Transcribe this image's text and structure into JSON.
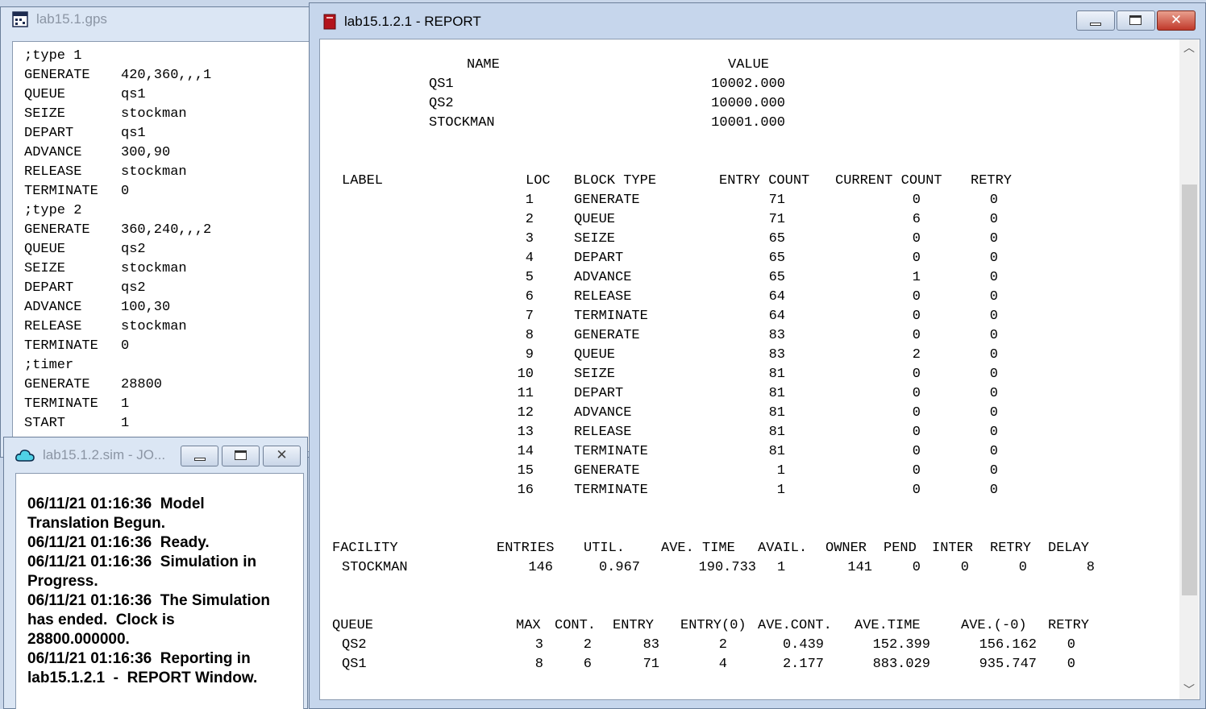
{
  "gps_window": {
    "title": "lab15.1.gps",
    "icon": "gps-file-icon",
    "lines": [
      {
        "kw": ";type 1",
        "arg": ""
      },
      {
        "kw": "GENERATE",
        "arg": "420,360,,,1"
      },
      {
        "kw": "QUEUE",
        "arg": "qs1"
      },
      {
        "kw": "SEIZE",
        "arg": "stockman"
      },
      {
        "kw": "DEPART",
        "arg": "qs1"
      },
      {
        "kw": "ADVANCE",
        "arg": "300,90"
      },
      {
        "kw": "RELEASE",
        "arg": "stockman"
      },
      {
        "kw": "TERMINATE",
        "arg": "0"
      },
      {
        "kw": ";type 2",
        "arg": ""
      },
      {
        "kw": "GENERATE",
        "arg": "360,240,,,2"
      },
      {
        "kw": "QUEUE",
        "arg": "qs2"
      },
      {
        "kw": "SEIZE",
        "arg": "stockman"
      },
      {
        "kw": "DEPART",
        "arg": "qs2"
      },
      {
        "kw": "ADVANCE",
        "arg": "100,30"
      },
      {
        "kw": "RELEASE",
        "arg": "stockman"
      },
      {
        "kw": "TERMINATE",
        "arg": "0"
      },
      {
        "kw": ";timer",
        "arg": ""
      },
      {
        "kw": "GENERATE",
        "arg": "28800"
      },
      {
        "kw": "TERMINATE",
        "arg": "1"
      },
      {
        "kw": "START",
        "arg": "1"
      }
    ]
  },
  "sim_window": {
    "title": "lab15.1.2.sim  -  JO...",
    "icon": "simulation-cloud-icon",
    "log_lines": [
      "06/11/21 01:16:36  Model",
      "Translation Begun.",
      "06/11/21 01:16:36  Ready.",
      "06/11/21 01:16:36  Simulation in",
      "Progress.",
      "06/11/21 01:16:36  The Simulation",
      "has ended.  Clock is",
      "28800.000000.",
      "06/11/21 01:16:36  Reporting in",
      "lab15.1.2.1  -  REPORT Window."
    ]
  },
  "report_window": {
    "title": "lab15.1.2.1  -  REPORT",
    "icon": "report-icon",
    "names_header": {
      "name": "NAME",
      "value": "VALUE"
    },
    "names": [
      {
        "name": "QS1",
        "value": "10002.000"
      },
      {
        "name": "QS2",
        "value": "10000.000"
      },
      {
        "name": "STOCKMAN",
        "value": "10001.000"
      }
    ],
    "blocks_header": {
      "label": "LABEL",
      "loc": "LOC",
      "type": "BLOCK TYPE",
      "entry": "ENTRY COUNT",
      "current": "CURRENT COUNT",
      "retry": "RETRY"
    },
    "blocks": [
      {
        "loc": "1",
        "type": "GENERATE",
        "entry": "71",
        "current": "0",
        "retry": "0"
      },
      {
        "loc": "2",
        "type": "QUEUE",
        "entry": "71",
        "current": "6",
        "retry": "0"
      },
      {
        "loc": "3",
        "type": "SEIZE",
        "entry": "65",
        "current": "0",
        "retry": "0"
      },
      {
        "loc": "4",
        "type": "DEPART",
        "entry": "65",
        "current": "0",
        "retry": "0"
      },
      {
        "loc": "5",
        "type": "ADVANCE",
        "entry": "65",
        "current": "1",
        "retry": "0"
      },
      {
        "loc": "6",
        "type": "RELEASE",
        "entry": "64",
        "current": "0",
        "retry": "0"
      },
      {
        "loc": "7",
        "type": "TERMINATE",
        "entry": "64",
        "current": "0",
        "retry": "0"
      },
      {
        "loc": "8",
        "type": "GENERATE",
        "entry": "83",
        "current": "0",
        "retry": "0"
      },
      {
        "loc": "9",
        "type": "QUEUE",
        "entry": "83",
        "current": "2",
        "retry": "0"
      },
      {
        "loc": "10",
        "type": "SEIZE",
        "entry": "81",
        "current": "0",
        "retry": "0"
      },
      {
        "loc": "11",
        "type": "DEPART",
        "entry": "81",
        "current": "0",
        "retry": "0"
      },
      {
        "loc": "12",
        "type": "ADVANCE",
        "entry": "81",
        "current": "0",
        "retry": "0"
      },
      {
        "loc": "13",
        "type": "RELEASE",
        "entry": "81",
        "current": "0",
        "retry": "0"
      },
      {
        "loc": "14",
        "type": "TERMINATE",
        "entry": "81",
        "current": "0",
        "retry": "0"
      },
      {
        "loc": "15",
        "type": "GENERATE",
        "entry": "1",
        "current": "0",
        "retry": "0"
      },
      {
        "loc": "16",
        "type": "TERMINATE",
        "entry": "1",
        "current": "0",
        "retry": "0"
      }
    ],
    "facility_header": [
      "FACILITY",
      "ENTRIES",
      "UTIL.",
      "AVE. TIME",
      "AVAIL.",
      "OWNER",
      "PEND",
      "INTER",
      "RETRY",
      "DELAY"
    ],
    "facility_rows": [
      [
        "STOCKMAN",
        "146",
        "0.967",
        "190.733",
        "1",
        "141",
        "0",
        "0",
        "0",
        "8"
      ]
    ],
    "queue_header": [
      "QUEUE",
      "MAX",
      "CONT.",
      "ENTRY",
      "ENTRY(0)",
      "AVE.CONT.",
      "AVE.TIME",
      "AVE.(-0)",
      "RETRY"
    ],
    "queue_rows": [
      [
        "QS2",
        "3",
        "2",
        "83",
        "2",
        "0.439",
        "152.399",
        "156.162",
        "0"
      ],
      [
        "QS1",
        "8",
        "6",
        "71",
        "4",
        "2.177",
        "883.029",
        "935.747",
        "0"
      ]
    ]
  },
  "colors": {
    "window_frame": "#dbe6f4",
    "close_button": "#c0392b",
    "report_icon": "#b3141c"
  }
}
